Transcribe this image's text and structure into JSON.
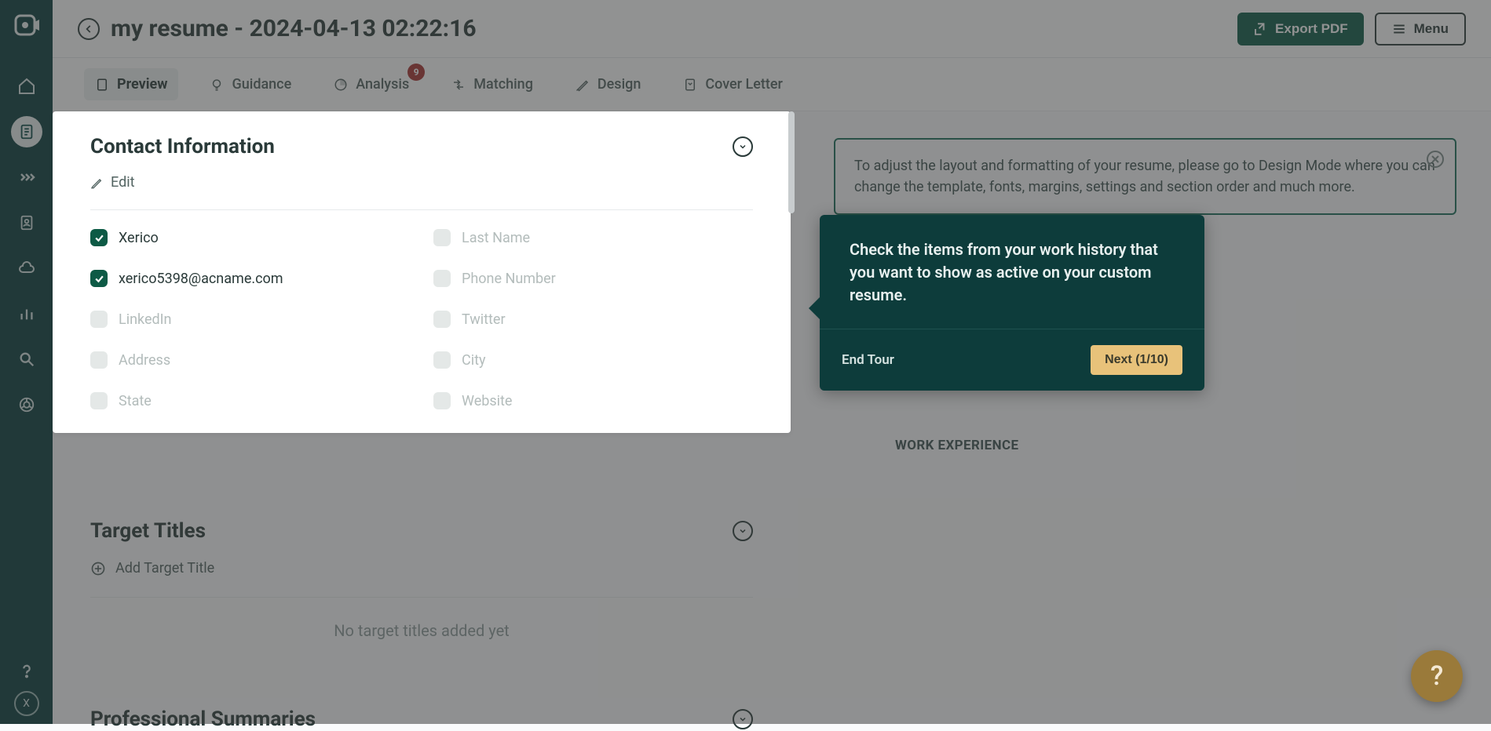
{
  "header": {
    "title": "my resume - 2024-04-13 02:22:16",
    "export_label": "Export PDF",
    "menu_label": "Menu"
  },
  "tabs": {
    "preview": "Preview",
    "guidance": "Guidance",
    "analysis": "Analysis",
    "analysis_badge": "9",
    "matching": "Matching",
    "design": "Design",
    "cover_letter": "Cover Letter"
  },
  "contact_panel": {
    "title": "Contact Information",
    "edit_label": "Edit",
    "fields": {
      "first_name": "Xerico",
      "last_name": "Last Name",
      "email": "xerico5398@acname.com",
      "phone": "Phone Number",
      "linkedin": "LinkedIn",
      "twitter": "Twitter",
      "address": "Address",
      "city": "City",
      "state": "State",
      "website": "Website"
    }
  },
  "target_titles": {
    "heading": "Target Titles",
    "add_label": "Add Target Title",
    "empty_msg": "No target titles added yet"
  },
  "prof_summaries": {
    "heading": "Professional Summaries"
  },
  "notice": {
    "text": "To adjust the layout and formatting of your resume, please go to Design Mode where you can change the template, fonts, margins, settings and section order and much more."
  },
  "right": {
    "work_exp_label": "WORK EXPERIENCE"
  },
  "tour": {
    "body": "Check the items from your work history that you want to show as active on your custom resume.",
    "end_label": "End Tour",
    "next_label": "Next (1/10)"
  },
  "avatar_letter": "X",
  "help_glyph": "?"
}
